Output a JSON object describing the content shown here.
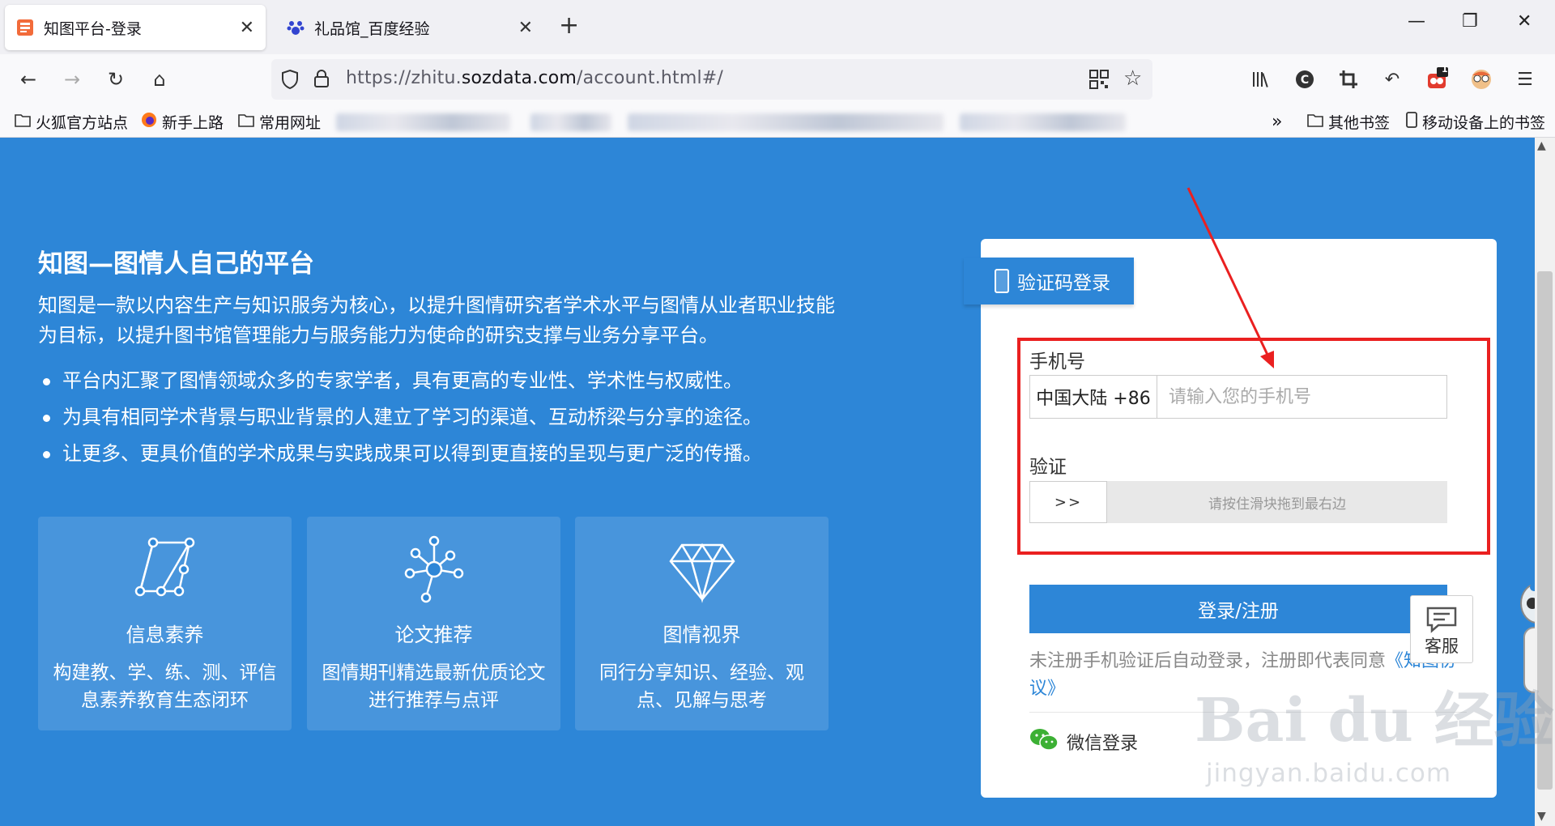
{
  "browser": {
    "tabs": [
      {
        "label": "知图平台-登录",
        "active": true
      },
      {
        "label": "礼品馆_百度经验",
        "active": false
      }
    ],
    "url": {
      "prefix": "https://zhitu.",
      "domain": "sozdata.com",
      "suffix": "/account.html#/"
    },
    "extension_badge": "1",
    "bookmarks": {
      "left": [
        "火狐官方站点",
        "新手上路",
        "常用网址"
      ],
      "right": [
        "其他书签",
        "移动设备上的书签"
      ]
    }
  },
  "intro": {
    "title": "知图—图情人自己的平台",
    "description": "知图是一款以内容生产与知识服务为核心，以提升图情研究者学术水平与图情从业者职业技能为目标，以提升图书馆管理能力与服务能力为使命的研究支撑与业务分享平台。",
    "bullets": [
      "平台内汇聚了图情领域众多的专家学者，具有更高的专业性、学术性与权威性。",
      "为具有相同学术背景与职业背景的人建立了学习的渠道、互动桥梁与分享的途径。",
      "让更多、更具价值的学术成果与实践成果可以得到更直接的呈现与更广泛的传播。"
    ]
  },
  "cards": [
    {
      "title": "信息素养",
      "desc": "构建教、学、练、测、评信息素养教育生态闭环"
    },
    {
      "title": "论文推荐",
      "desc": "图情期刊精选最新优质论文进行推荐与点评"
    },
    {
      "title": "图情视界",
      "desc": "同行分享知识、经验、观点、见解与思考"
    }
  ],
  "login": {
    "tab_label": "验证码登录",
    "phone_label": "手机号",
    "country_code": "中国大陆 +86",
    "phone_placeholder": "请输入您的手机号",
    "verify_label": "验证",
    "slider_handle": ">>",
    "slider_hint": "请按住滑块拖到最右边",
    "submit_label": "登录/注册",
    "agreement_text": "未注册手机验证后自动登录，注册即代表同意",
    "agreement_link": "《知图协议》",
    "wechat_label": "微信登录"
  },
  "kefu_label": "客服",
  "watermark": {
    "logo": "Bai du 经验",
    "site": "jingyan.baidu.com"
  },
  "colors": {
    "primary": "#2d86d7",
    "annotation": "#ea2020"
  }
}
